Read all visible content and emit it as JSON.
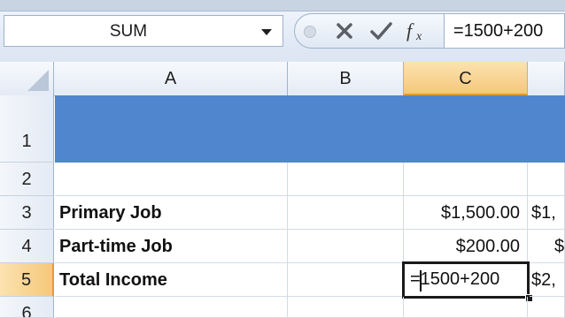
{
  "formula_bar": {
    "name_box": "SUM",
    "cancel_icon": "close-icon",
    "enter_icon": "check-icon",
    "function_icon": "fx-icon",
    "formula": "=1500+200"
  },
  "columns": [
    "A",
    "B",
    "C",
    ""
  ],
  "active_column": "C",
  "rows": [
    "1",
    "2",
    "3",
    "4",
    "5",
    "6"
  ],
  "active_row": "5",
  "header_band_color": "#4f86cd",
  "cells": {
    "r3": {
      "a": "Primary Job",
      "c": "$1,500.00",
      "d": "$1,"
    },
    "r4": {
      "a": "Part-time Job",
      "c": "$200.00",
      "d": "$"
    },
    "r5": {
      "a": "Total Income",
      "c": "=1500+200",
      "d": "$2,"
    }
  }
}
